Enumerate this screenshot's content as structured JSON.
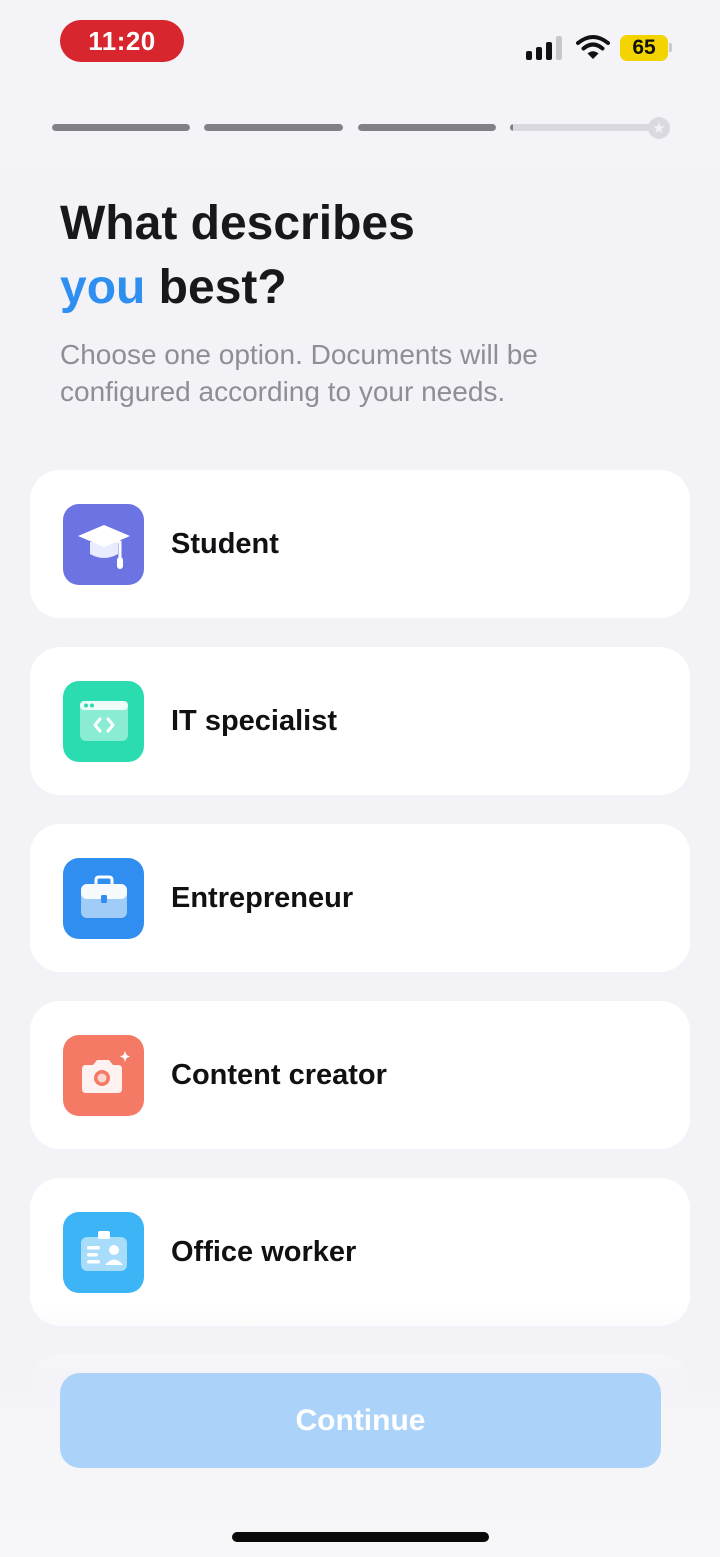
{
  "status_bar": {
    "time": "11:20",
    "battery": "65"
  },
  "progress": {
    "segments": [
      1,
      1,
      1,
      0.02
    ],
    "colors": {
      "filled": "#808087",
      "track": "#d9d9df"
    }
  },
  "header": {
    "title_line1": "What describes",
    "title_accent": "you",
    "title_rest": " best?",
    "subtitle": "Choose one option. Documents will be configured according to your needs."
  },
  "options": [
    {
      "label": "Student",
      "icon": "graduation-cap-icon",
      "color": "#6c74e4"
    },
    {
      "label": "IT specialist",
      "icon": "code-window-icon",
      "color": "#2bdcb0"
    },
    {
      "label": "Entrepreneur",
      "icon": "briefcase-icon",
      "color": "#2f8ef0"
    },
    {
      "label": "Content creator",
      "icon": "camera-icon",
      "color": "#f47a66"
    },
    {
      "label": "Office worker",
      "icon": "id-badge-icon",
      "color": "#3cb4f5"
    }
  ],
  "footer": {
    "continue_label": "Continue",
    "accent": "#abd3fa"
  }
}
